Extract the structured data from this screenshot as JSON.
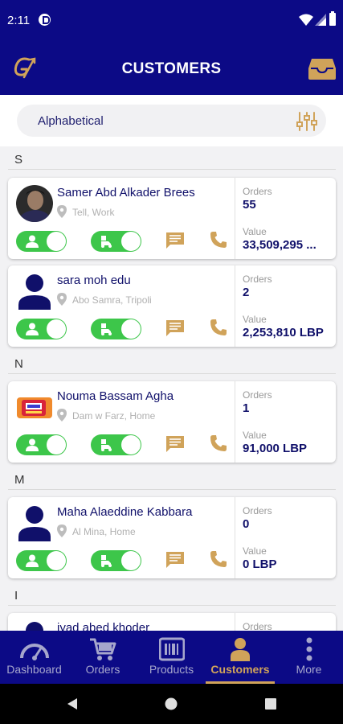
{
  "status_bar": {
    "time": "2:11"
  },
  "app_bar": {
    "title": "CUSTOMERS"
  },
  "sort": {
    "label": "Alphabetical"
  },
  "sections": [
    {
      "letter": "S",
      "customers": [
        {
          "name": "Samer Abd Alkader Brees",
          "location": "Tell, Work",
          "orders_label": "Orders",
          "orders": "55",
          "value_label": "Value",
          "value": "33,509,295 ..."
        },
        {
          "name": "sara moh edu",
          "location": "Abo Samra, Tripoli",
          "orders_label": "Orders",
          "orders": "2",
          "value_label": "Value",
          "value": "2,253,810 LBP"
        }
      ]
    },
    {
      "letter": "N",
      "customers": [
        {
          "name": "Nouma Bassam Agha",
          "location": "Dam w Farz, Home",
          "orders_label": "Orders",
          "orders": "1",
          "value_label": "Value",
          "value": "91,000 LBP"
        }
      ]
    },
    {
      "letter": "M",
      "customers": [
        {
          "name": "Maha Alaeddine Kabbara",
          "location": "Al Mina, Home",
          "orders_label": "Orders",
          "orders": "0",
          "value_label": "Value",
          "value": "0 LBP"
        }
      ]
    },
    {
      "letter": "I",
      "customers": [
        {
          "name": "iyad abed khoder",
          "orders_label": "Orders"
        }
      ]
    }
  ],
  "bottom_nav": [
    {
      "label": "Dashboard",
      "icon": "speedometer-icon"
    },
    {
      "label": "Orders",
      "icon": "cart-icon"
    },
    {
      "label": "Products",
      "icon": "barcode-icon"
    },
    {
      "label": "Customers",
      "icon": "person-icon",
      "active": true
    },
    {
      "label": "More",
      "icon": "more-vertical-icon"
    }
  ],
  "colors": {
    "primary": "#0c0a86",
    "accent": "#d0a35a",
    "toggle_on": "#3dc64a",
    "text_dark": "#10106a"
  }
}
